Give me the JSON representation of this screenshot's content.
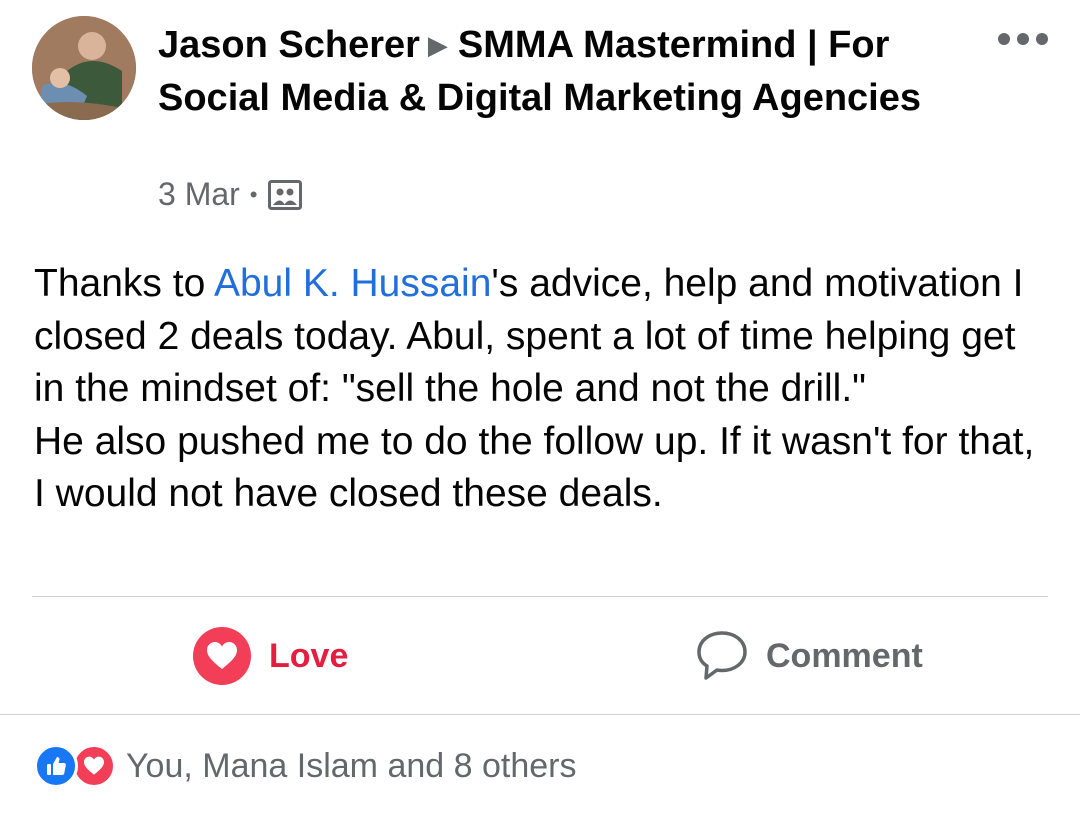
{
  "post": {
    "author": "Jason Scherer",
    "group": "SMMA Mastermind | For Social Media & Digital Marketing Agencies",
    "date": "3 Mar",
    "separator": "•",
    "text_before_mention": "Thanks to ",
    "mention": "Abul K. Hussain",
    "text_after_mention": "'s advice, help and motivation I closed 2 deals today. Abul, spent a lot of time helping get in the mindset of: \"sell the hole and not the drill.\"",
    "text_line2": "He also pushed me to do the follow up. If it wasn't for that, I would not have closed these deals."
  },
  "actions": {
    "love_label": "Love",
    "comment_label": "Comment"
  },
  "reactions": {
    "summary": "You, Mana Islam and 8 others"
  },
  "colors": {
    "mention_blue": "#216fdb",
    "love_red": "#e41e3f",
    "like_blue": "#1877f2",
    "secondary_gray": "#65676b"
  },
  "icons": {
    "more": "more-options-icon",
    "audience": "group-audience-icon",
    "love": "love-reaction-icon",
    "comment": "comment-icon",
    "like": "like-reaction-icon"
  }
}
